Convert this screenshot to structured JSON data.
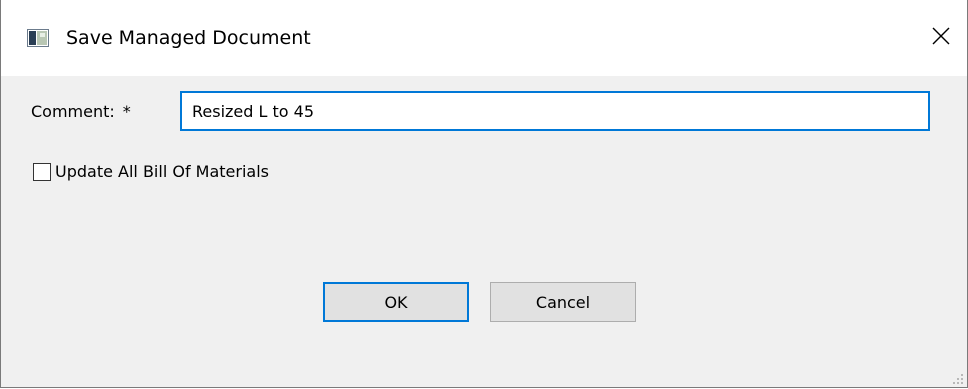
{
  "window": {
    "title": "Save Managed Document",
    "icon": "app-window-icon",
    "close_icon": "close-icon"
  },
  "form": {
    "comment_label": "Comment:",
    "required_marker": "*",
    "comment_value": "Resized L to 45",
    "checkbox_label": "Update All Bill Of Materials",
    "checkbox_checked": false
  },
  "buttons": {
    "ok_label": "OK",
    "cancel_label": "Cancel"
  },
  "colors": {
    "accent": "#0078d7",
    "dialog_bg": "#f0f0f0",
    "button_bg": "#e1e1e1"
  }
}
